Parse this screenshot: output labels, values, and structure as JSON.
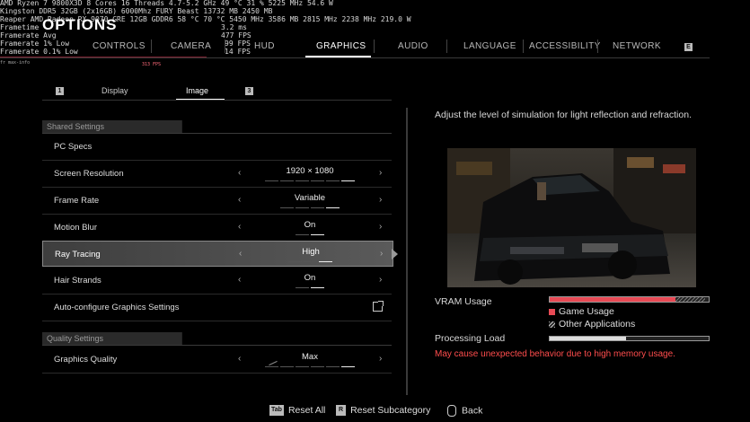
{
  "overlay": {
    "line1": "AMD Ryzen 7 9800X3D 8 Cores 16 Threads 4.7-5.2 GHz   49 °C     31 %   5225 MHz  54.6 W",
    "line2": "Kingston DDR5 32GB (2x16GB) 6000Mhz FURY Beast   13732 MB   2450 MB",
    "line3": "Reaper AMD Radeon RX 9070 GRE 12GB GDDR6         58 °C     70 °C  5450 MHz  3586 MB  2815 MHz  2238 MHz  219.0 W",
    "frametime_label": "Frametime",
    "frametime_value": "3.2 ms",
    "fps_avg_label": "Framerate Avg",
    "fps_avg_value": "477 FPS",
    "fps_low1_label": "Framerate 1% Low",
    "fps_low1_value": "99 FPS",
    "fps_low01_label": "Framerate 0.1% Low",
    "fps_low01_value": "14 FPS",
    "tiny_left": "fr max-info",
    "tiny_right": "313 FPS"
  },
  "header": {
    "title": "OPTIONS",
    "tabs": [
      "CONTROLS",
      "CAMERA",
      "HUD",
      "GRAPHICS",
      "AUDIO",
      "LANGUAGE",
      "ACCESSIBILITY",
      "NETWORK"
    ],
    "active_tab": "GRAPHICS",
    "next_key": "E"
  },
  "subtabs": {
    "prev_key": "1",
    "items": [
      "Display",
      "Image"
    ],
    "active": "Image",
    "next_key": "3"
  },
  "settings": {
    "shared_header": "Shared Settings",
    "pc_specs": "PC Specs",
    "screen_resolution": {
      "label": "Screen Resolution",
      "value": "1920 × 1080"
    },
    "frame_rate": {
      "label": "Frame Rate",
      "value": "Variable"
    },
    "motion_blur": {
      "label": "Motion Blur",
      "value": "On"
    },
    "ray_tracing": {
      "label": "Ray Tracing",
      "value": "High"
    },
    "hair_strands": {
      "label": "Hair Strands",
      "value": "On"
    },
    "auto_configure": "Auto-configure Graphics Settings",
    "quality_header": "Quality Settings",
    "graphics_quality": {
      "label": "Graphics Quality",
      "value": "Max"
    }
  },
  "panel": {
    "description": "Adjust the level of simulation for light reflection and refraction.",
    "vram_label": "VRAM Usage",
    "vram_game_fraction": 0.79,
    "vram_other_fraction": 0.19,
    "legend_game": "Game Usage",
    "legend_other": "Other Applications",
    "processing_label": "Processing Load",
    "processing_fraction": 0.48,
    "warning": "May cause unexpected behavior due to high memory usage.",
    "colors": {
      "game": "#e84a55",
      "warning": "#ff4d4d"
    }
  },
  "footer": {
    "reset_all_key": "Tab",
    "reset_all": "Reset All",
    "reset_sub_key": "R",
    "reset_sub": "Reset Subcategory",
    "back": "Back"
  }
}
